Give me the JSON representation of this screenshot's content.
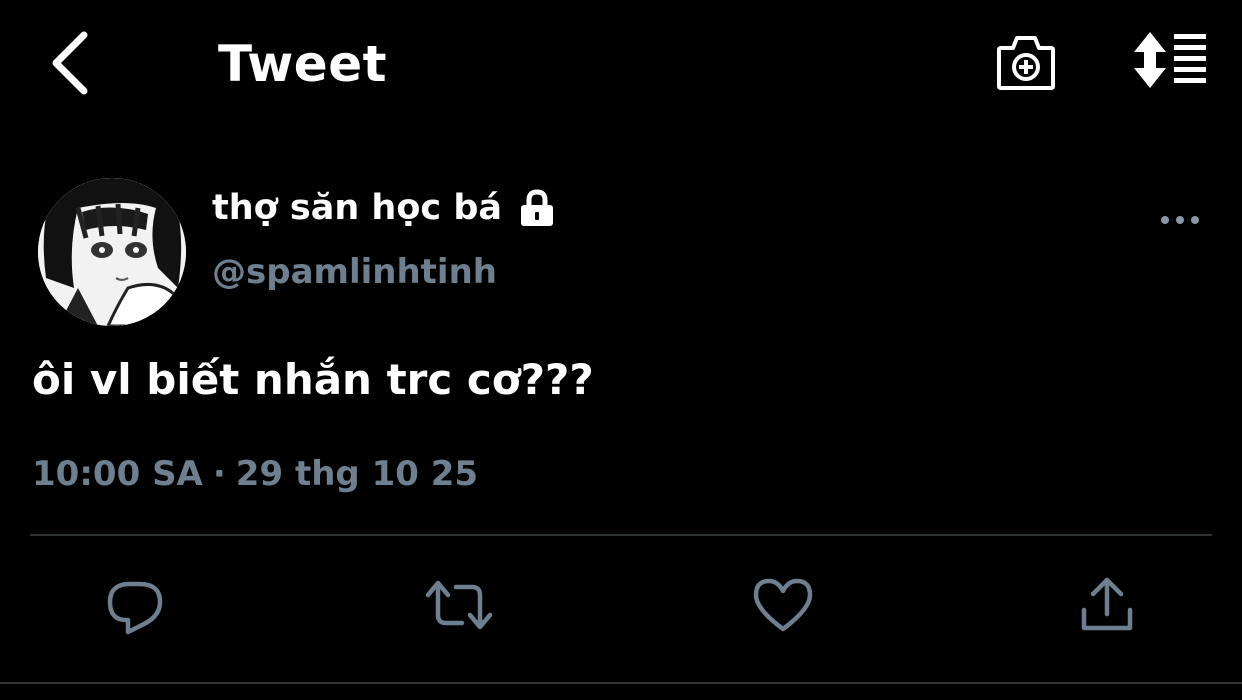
{
  "header": {
    "title": "Tweet",
    "back_icon": "chevron-left-icon",
    "camera_icon": "camera-plus-icon",
    "sort_icon": "sort-lines-icon"
  },
  "author": {
    "display_name": "thợ săn học bá",
    "handle": "@spamlinhtinh",
    "protected_icon": "lock-icon",
    "more_icon": "more-horizontal-icon"
  },
  "tweet": {
    "text": "ôi vl biết nhắn trc cơ???",
    "time": "10:00 SA",
    "separator": "·",
    "date": "29 thg 10 25"
  },
  "actions": {
    "reply_icon": "reply-icon",
    "retweet_icon": "retweet-icon",
    "like_icon": "heart-icon",
    "share_icon": "share-icon"
  },
  "colors": {
    "background": "#000000",
    "text": "#ffffff",
    "secondary": "#6e7f8f",
    "divider": "#2f3336"
  }
}
